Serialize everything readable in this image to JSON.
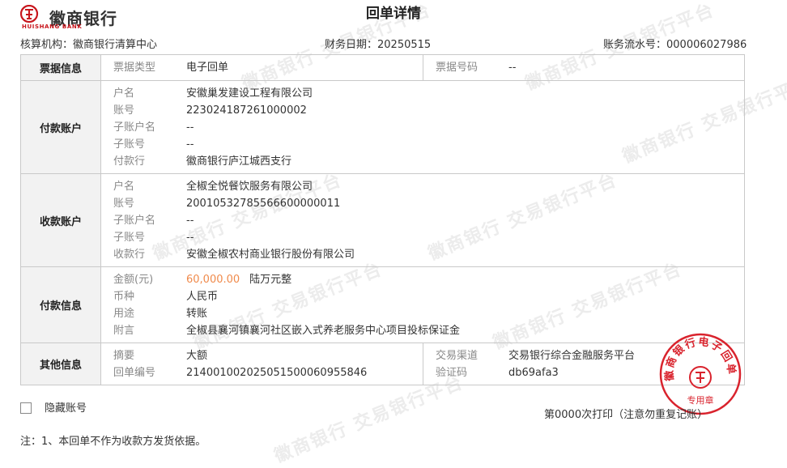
{
  "header": {
    "bank_name_cn": "徽商银行",
    "bank_name_en": "HUISHANG BANK",
    "title": "回单详情"
  },
  "meta": {
    "org_label": "核算机构：",
    "org_value": "徽商银行清算中心",
    "date_label": "财务日期：",
    "date_value": "20250515",
    "serial_label": "账务流水号：",
    "serial_value": "000006027986"
  },
  "ticket": {
    "section": "票据信息",
    "type_label": "票据类型",
    "type_value": "电子回单",
    "number_label": "票据号码",
    "number_value": "--"
  },
  "payer": {
    "section": "付款账户",
    "rows": [
      {
        "label": "户名",
        "value": "安徽巢发建设工程有限公司"
      },
      {
        "label": "账号",
        "value": "223024187261000002"
      },
      {
        "label": "子账户名",
        "value": "--"
      },
      {
        "label": "子账号",
        "value": "--"
      },
      {
        "label": "付款行",
        "value": "徽商银行庐江城西支行"
      }
    ]
  },
  "payee": {
    "section": "收款账户",
    "rows": [
      {
        "label": "户名",
        "value": "全椒全悦餐饮服务有限公司"
      },
      {
        "label": "账号",
        "value": "20010532785566600000011"
      },
      {
        "label": "子账户名",
        "value": "--"
      },
      {
        "label": "子账号",
        "value": "--"
      },
      {
        "label": "收款行",
        "value": "安徽全椒农村商业银行股份有限公司"
      }
    ]
  },
  "payment": {
    "section": "付款信息",
    "amount_label": "金额(元)",
    "amount_value": "60,000.00",
    "amount_cn": "陆万元整",
    "currency_label": "币种",
    "currency_value": "人民币",
    "purpose_label": "用途",
    "purpose_value": "转账",
    "note_label": "附言",
    "note_value": "全椒县襄河镇襄河社区嵌入式养老服务中心项目投标保证金"
  },
  "other": {
    "section": "其他信息",
    "summary_label": "摘要",
    "summary_value": "大额",
    "receipt_label": "回单编号",
    "receipt_value": "2140010020250515000609558​46",
    "channel_label": "交易渠道",
    "channel_value": "交易银行综合金融服务平台",
    "code_label": "验证码",
    "code_value": "db69afa3"
  },
  "footer": {
    "hide_account_label": "隐藏账号",
    "print_text": "第0000次打印（注意勿重复记账）",
    "note_text": "注：1、本回单不作为收款方发货依据。"
  },
  "stamp": {
    "ring_text": "徽商银行电子回单",
    "center_text": "专用章",
    "color": "#d9232d"
  },
  "watermark_text": "徽商银行 交易银行平台",
  "colors": {
    "brand": "#c8161d",
    "amount": "#f08a4b"
  }
}
